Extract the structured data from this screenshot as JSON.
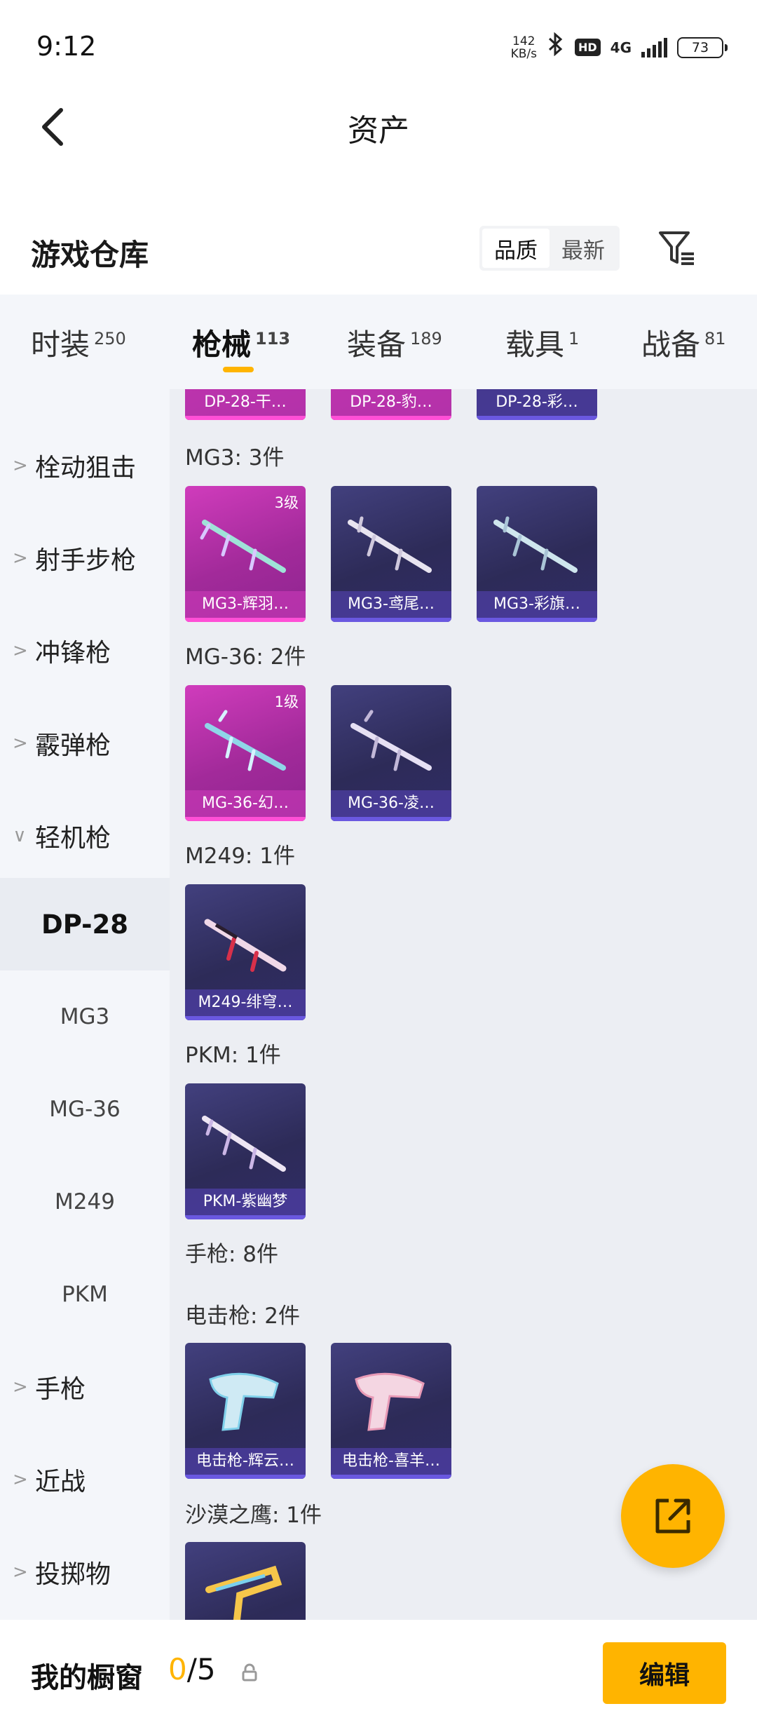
{
  "status_bar": {
    "time": "9:12",
    "net_speed_value": "142",
    "net_speed_unit": "KB/s",
    "hd": "HD",
    "network": "4G",
    "battery": "73"
  },
  "header": {
    "title": "资产"
  },
  "warehouse": {
    "title": "游戏仓库",
    "sort_options": [
      {
        "label": "品质",
        "active": true
      },
      {
        "label": "最新",
        "active": false
      }
    ]
  },
  "tabs": [
    {
      "label": "时装",
      "count": "250"
    },
    {
      "label": "枪械",
      "count": "113"
    },
    {
      "label": "装备",
      "count": "189"
    },
    {
      "label": "载具",
      "count": "1"
    },
    {
      "label": "战备",
      "count": "81"
    }
  ],
  "active_tab_index": 1,
  "sidebar": {
    "items": [
      {
        "label": "栓动狙击",
        "chevron": ">"
      },
      {
        "label": "射手步枪",
        "chevron": ">"
      },
      {
        "label": "冲锋枪",
        "chevron": ">"
      },
      {
        "label": "霰弹枪",
        "chevron": ">"
      },
      {
        "label": "轻机枪",
        "chevron": "∨"
      }
    ],
    "subitems": [
      "DP-28",
      "MG3",
      "MG-36",
      "M249",
      "PKM"
    ],
    "active_subitem": "DP-28",
    "items_after": [
      {
        "label": "手枪",
        "chevron": ">"
      },
      {
        "label": "近战",
        "chevron": ">"
      },
      {
        "label": "投掷物",
        "chevron": ">"
      }
    ]
  },
  "content": {
    "top_row": [
      {
        "name": "DP-28-干…",
        "rarity": "pink"
      },
      {
        "name": "DP-28-豹…",
        "rarity": "pink"
      },
      {
        "name": "DP-28-彩…",
        "rarity": "purple"
      }
    ],
    "groups": [
      {
        "title": "MG3: 3件",
        "cards": [
          {
            "name": "MG3-辉羽…",
            "rarity": "pink",
            "level": "3级"
          },
          {
            "name": "MG3-鸢尾…",
            "rarity": "purple",
            "level": ""
          },
          {
            "name": "MG3-彩旗…",
            "rarity": "purple",
            "level": ""
          }
        ]
      },
      {
        "title": "MG-36: 2件",
        "cards": [
          {
            "name": "MG-36-幻…",
            "rarity": "pink",
            "level": "1级"
          },
          {
            "name": "MG-36-凌…",
            "rarity": "purple",
            "level": ""
          }
        ]
      },
      {
        "title": "M249: 1件",
        "cards": [
          {
            "name": "M249-绯穹…",
            "rarity": "purple",
            "level": ""
          }
        ]
      },
      {
        "title": "PKM: 1件",
        "cards": [
          {
            "name": "PKM-紫幽梦",
            "rarity": "purple",
            "level": ""
          }
        ]
      },
      {
        "title": "手枪: 8件",
        "cards": []
      },
      {
        "title": "电击枪: 2件",
        "cards": [
          {
            "name": "电击枪-辉云…",
            "rarity": "purple",
            "level": ""
          },
          {
            "name": "电击枪-喜羊…",
            "rarity": "purple",
            "level": ""
          }
        ]
      },
      {
        "title": "沙漠之鹰: 1件",
        "cards": [
          {
            "name": "",
            "rarity": "purple",
            "level": ""
          }
        ]
      }
    ]
  },
  "bottom_bar": {
    "label": "我的橱窗",
    "used": "0",
    "total": "/5",
    "edit_label": "编辑"
  },
  "colors": {
    "accent": "#ffb400",
    "card_purple": "#3a3770",
    "card_pink": "#c034b4",
    "panel_bg": "#f4f6fa",
    "content_bg": "#eceef3"
  }
}
